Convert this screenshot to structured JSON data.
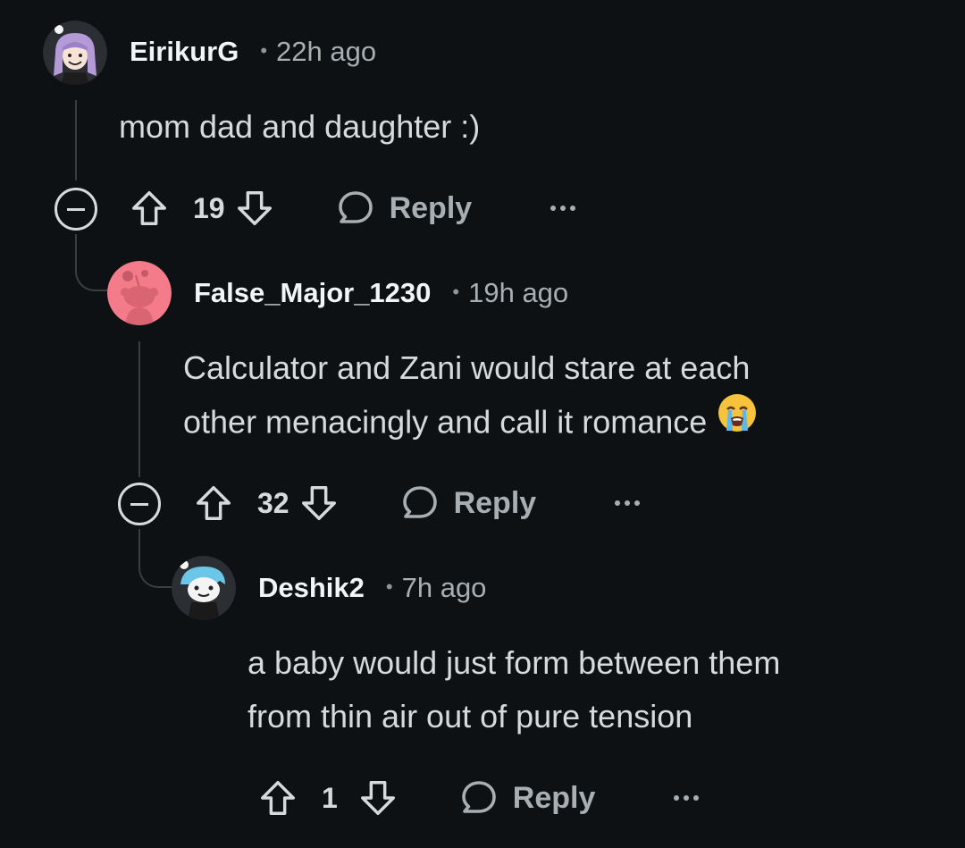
{
  "comments": [
    {
      "username": "EirikurG",
      "separator": "•",
      "time": "22h ago",
      "body_lines": [
        "mom dad and daughter :)"
      ],
      "score": "19",
      "reply_label": "Reply",
      "avatar_icon": "anime-girl-avatar-icon"
    },
    {
      "username": "False_Major_1230",
      "separator": "•",
      "time": "19h ago",
      "body_lines": [
        "Calculator and Zani would stare at each",
        "other menacingly and call it romance"
      ],
      "emoji": "loudly-crying-face-emoji",
      "score": "32",
      "reply_label": "Reply",
      "avatar_icon": "snoo-default-avatar-icon"
    },
    {
      "username": "Deshik2",
      "separator": "•",
      "time": "7h ago",
      "body_lines": [
        "a baby would just form between them",
        "from thin air out of pure tension"
      ],
      "score": "1",
      "reply_label": "Reply",
      "avatar_icon": "snoo-blue-hair-avatar-icon"
    }
  ],
  "colors": {
    "background": "#0e1113",
    "text": "#d7dadc",
    "muted": "#a8aeb2",
    "thread_line": "#3a3d40",
    "avatar_pink": "#f47b8a"
  }
}
